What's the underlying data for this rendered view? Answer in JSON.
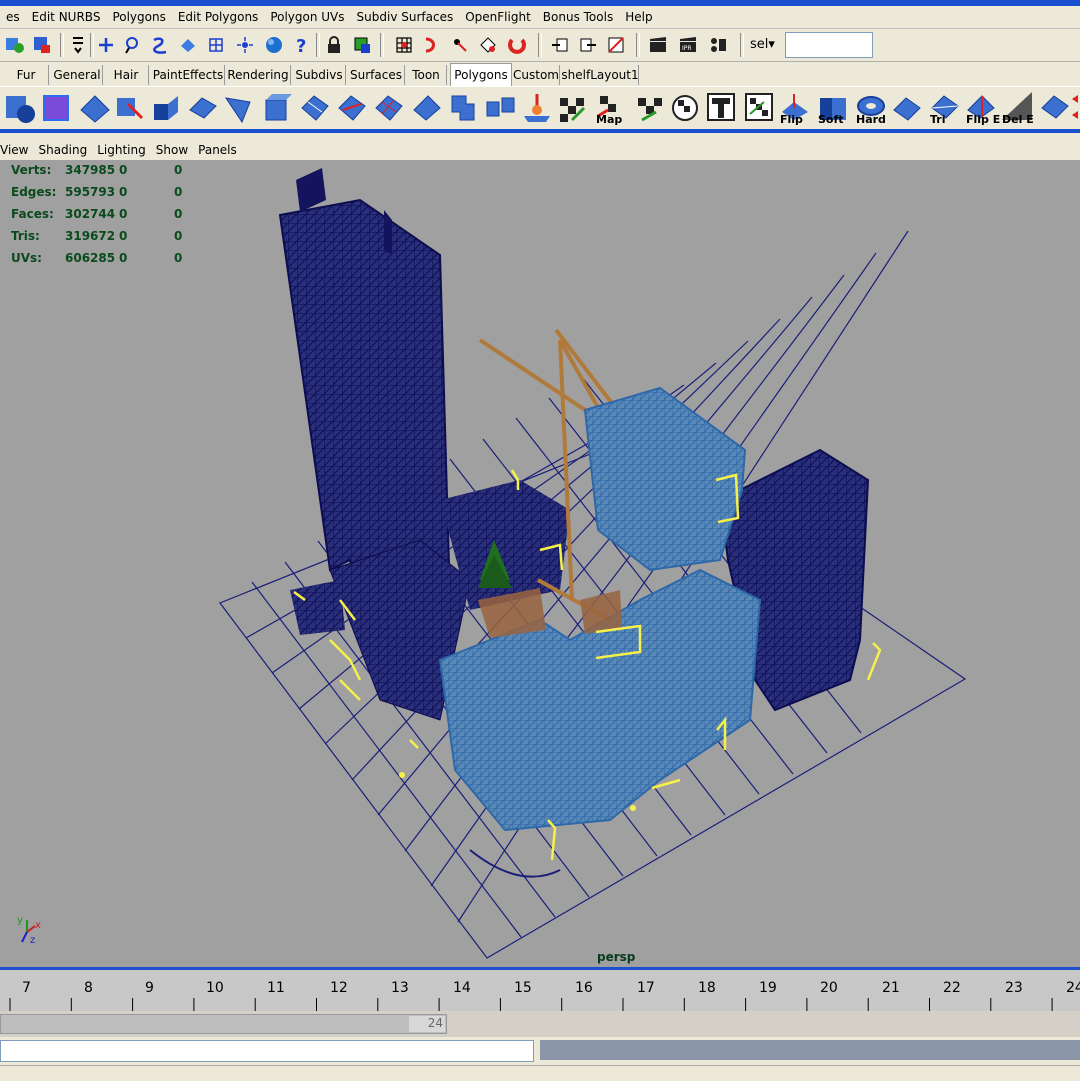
{
  "menu": [
    "es",
    "Edit NURBS",
    "Polygons",
    "Edit Polygons",
    "Polygon UVs",
    "Subdiv Surfaces",
    "OpenFlight",
    "Bonus Tools",
    "Help"
  ],
  "status": {
    "sel_label": "sel",
    "sel_value": ""
  },
  "shelf_tabs": [
    "Fur",
    "General",
    "Hair",
    "PaintEffects",
    "Rendering",
    "Subdivs",
    "Surfaces",
    "Toon",
    "Polygons",
    "Custom",
    "shelfLayout1"
  ],
  "active_tab": "Polygons",
  "shelf_labels": {
    "map": "Map",
    "flip": "Flip",
    "soft": "Soft",
    "hard": "Hard",
    "tri": "Tri",
    "flip_e": "Flip E",
    "del_e": "Del E"
  },
  "panel_menu": [
    "View",
    "Shading",
    "Lighting",
    "Show",
    "Panels"
  ],
  "hud": {
    "rows": [
      {
        "label": "Verts:",
        "a": "347985",
        "b": "0",
        "c": "0"
      },
      {
        "label": "Edges:",
        "a": "595793",
        "b": "0",
        "c": "0"
      },
      {
        "label": "Faces:",
        "a": "302744",
        "b": "0",
        "c": "0"
      },
      {
        "label": "Tris:",
        "a": "319672",
        "b": "0",
        "c": "0"
      },
      {
        "label": "UVs:",
        "a": "606285",
        "b": "0",
        "c": "0"
      }
    ]
  },
  "camera_label": "persp",
  "axis": {
    "y": "y",
    "x": "x",
    "z": "z"
  },
  "timeline": {
    "ticks": [
      "7",
      "8",
      "9",
      "10",
      "11",
      "12",
      "13",
      "14",
      "15",
      "16",
      "17",
      "18",
      "19",
      "20",
      "21",
      "22",
      "23",
      "24"
    ]
  },
  "range": {
    "end": "24"
  },
  "colors": {
    "menu_bg": "#ece9d8",
    "viewport": "#a0a0a0",
    "wire_dark": "#14135e",
    "wire_light": "#3e7bb8",
    "crane": "#b07a3a",
    "highlight": "#f5f04a",
    "accent": "#1a4fd0"
  }
}
